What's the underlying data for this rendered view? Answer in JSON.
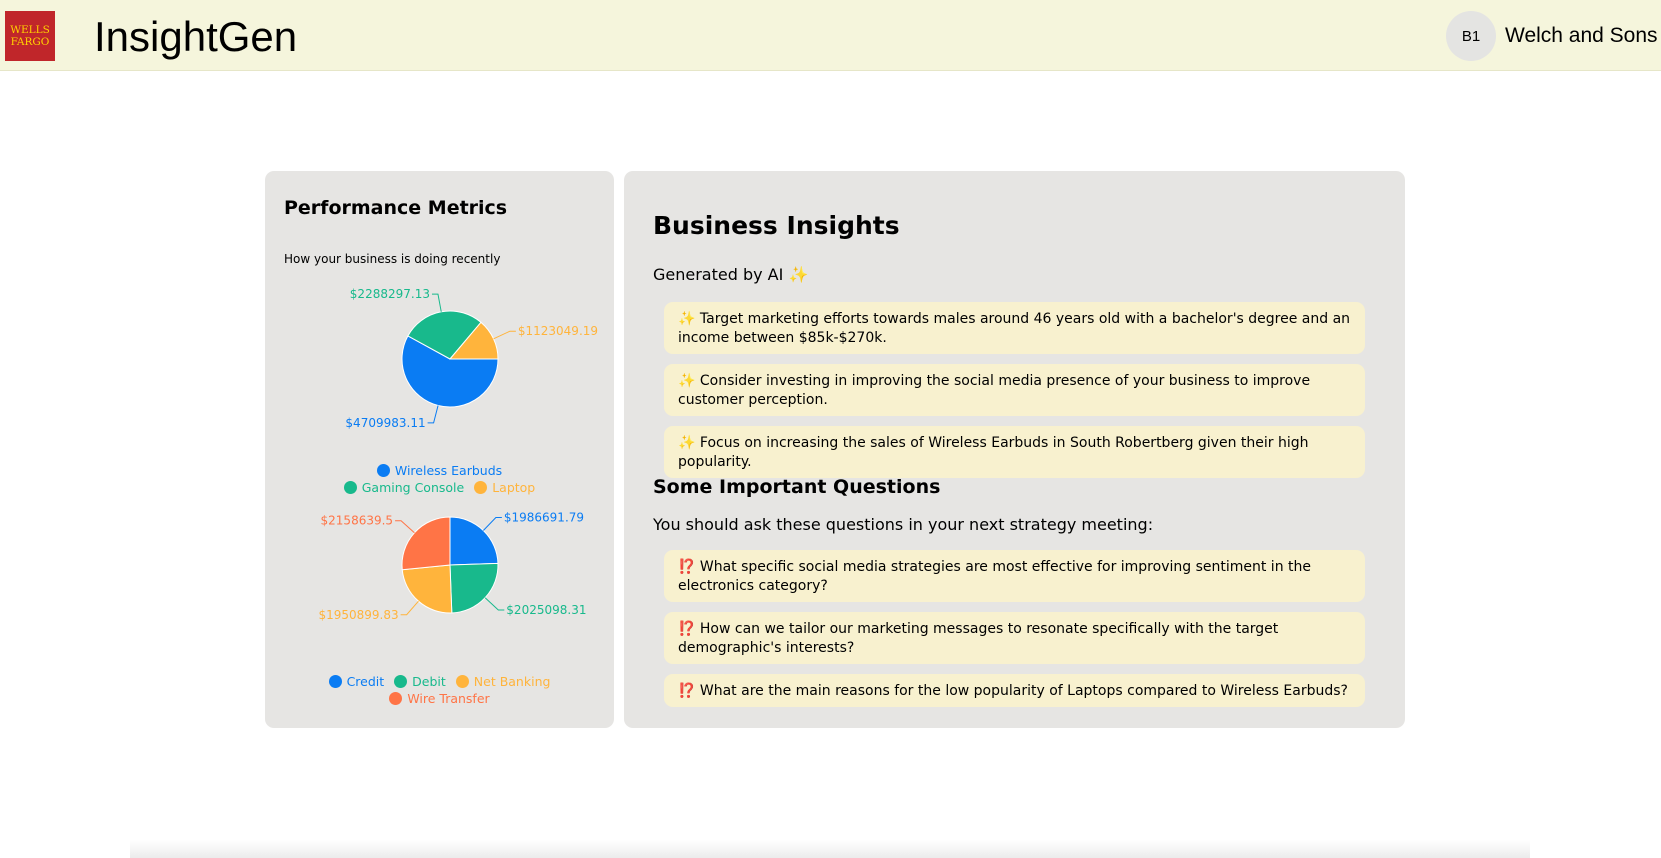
{
  "header": {
    "logo_line1": "WELLS",
    "logo_line2": "FARGO",
    "app_title": "InsightGen",
    "avatar_initials": "B1",
    "company_name": "Welch and Sons"
  },
  "metrics": {
    "title": "Performance Metrics",
    "subtitle": "How your business is doing recently"
  },
  "chart_data": [
    {
      "type": "pie",
      "categories": [
        "Wireless Earbuds",
        "Gaming Console",
        "Laptop"
      ],
      "values": [
        4709983.11,
        2288297.13,
        1123049.19
      ],
      "labels": [
        "$4709983.11",
        "$2288297.13",
        "$1123049.19"
      ],
      "colors": [
        "#0a7cf3",
        "#18b98c",
        "#ffb43c"
      ],
      "legend": "bottom"
    },
    {
      "type": "pie",
      "categories": [
        "Credit",
        "Debit",
        "Net Banking",
        "Wire Transfer"
      ],
      "values": [
        1986691.79,
        2025098.31,
        1950899.83,
        2158639.5
      ],
      "labels": [
        "$1986691.79",
        "$2025098.31",
        "$1950899.83",
        "$2158639.5"
      ],
      "colors": [
        "#0a7cf3",
        "#18b98c",
        "#ffb43c",
        "#ff7446"
      ],
      "legend": "bottom"
    }
  ],
  "insights": {
    "title": "Business Insights",
    "subtitle": "Generated by AI",
    "spark": "✨",
    "items": [
      "Target marketing efforts towards males around 46 years old with a bachelor's degree and an income between $85k-$270k.",
      "Consider investing in improving the social media presence of your business to improve customer perception.",
      "Focus on increasing the sales of Wireless Earbuds in South Robertberg given their high popularity."
    ]
  },
  "questions": {
    "title": "Some Important Questions",
    "subtitle": "You should ask these questions in your next strategy meeting:",
    "mark": "⁉️",
    "items": [
      "What specific social media strategies are most effective for improving sentiment in the electronics category?",
      "How can we tailor our marketing messages to resonate specifically with the target demographic's interests?",
      "What are the main reasons for the low popularity of Laptops compared to Wireless Earbuds?"
    ]
  }
}
